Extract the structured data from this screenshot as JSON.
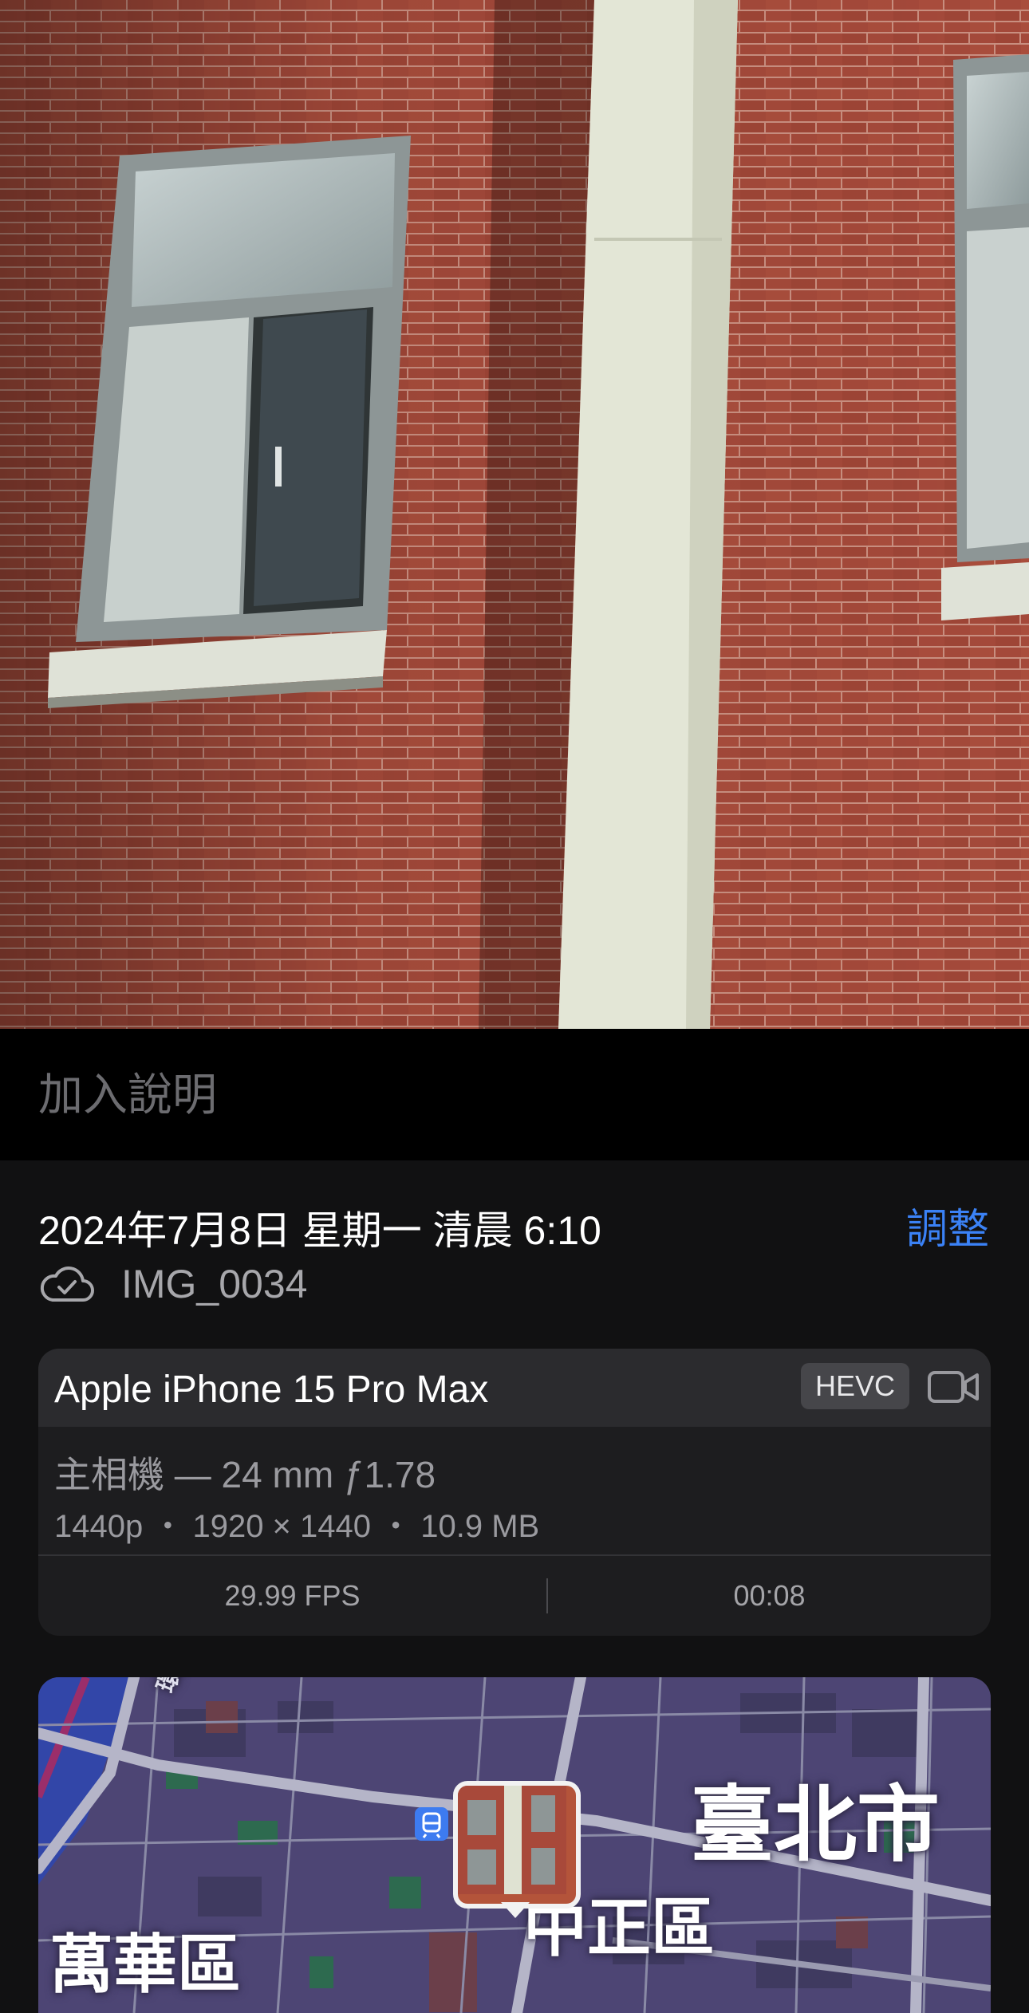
{
  "caption": {
    "placeholder": "加入說明"
  },
  "info": {
    "datetime": "2024年7月8日 星期一 清晨 6:10",
    "adjust_label": "調整",
    "file_name": "IMG_0034",
    "cloud_icon": "icloud-icon"
  },
  "camera": {
    "device": "Apple iPhone 15 Pro Max",
    "codec": "HEVC",
    "media_icon": "video-camera-icon",
    "lens": "主相機 — 24 mm ƒ1.78",
    "specs": "1440p ・ 1920 × 1440 ・ 10.9 MB",
    "fps": "29.99 FPS",
    "duration": "00:08"
  },
  "map": {
    "city": "臺北市",
    "districts": [
      "中正區",
      "萬華區"
    ],
    "river": "環河",
    "transit_icon": "metro-station-icon"
  },
  "colors": {
    "accent": "#3b82f6",
    "sheet_bg": "#111112",
    "card_bg": "#1d1d1f"
  }
}
